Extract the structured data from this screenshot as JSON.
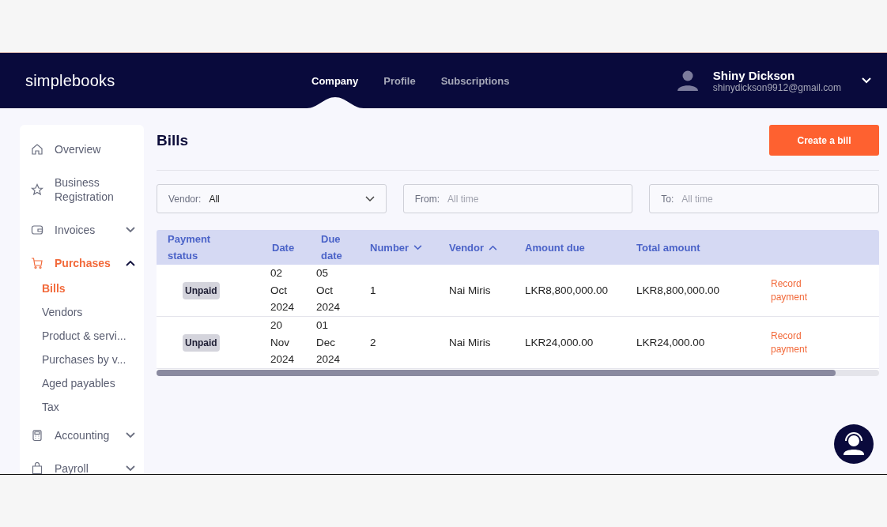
{
  "brand": "simplebooks",
  "nav_tabs": [
    {
      "label": "Company",
      "selected": true
    },
    {
      "label": "Profile",
      "selected": false
    },
    {
      "label": "Subscriptions",
      "selected": false
    }
  ],
  "user": {
    "name": "Shiny Dickson",
    "email": "shinydickson9912@gmail.com"
  },
  "sidebar": {
    "items": [
      {
        "label": "Overview",
        "selected": false
      },
      {
        "label": "Business Registration",
        "selected": false
      },
      {
        "label": "Invoices",
        "selected": false,
        "expanded": false
      },
      {
        "label": "Purchases",
        "selected": true,
        "expanded": true,
        "children": [
          {
            "label": "Bills",
            "selected": true
          },
          {
            "label": "Vendors",
            "selected": false
          },
          {
            "label": "Product & servi...",
            "selected": false
          },
          {
            "label": "Purchases by v...",
            "selected": false
          },
          {
            "label": "Aged payables",
            "selected": false
          },
          {
            "label": "Tax",
            "selected": false
          }
        ]
      },
      {
        "label": "Accounting",
        "selected": false,
        "expanded": false
      },
      {
        "label": "Payroll",
        "selected": false,
        "expanded": false
      }
    ]
  },
  "page_title": "Bills",
  "create_button": "Create a bill",
  "filters": [
    {
      "label": "Vendor:",
      "value": "All",
      "kind": "dropdown"
    },
    {
      "label": "From:",
      "placeholder": "All time",
      "kind": "date"
    },
    {
      "label": "To:",
      "placeholder": "All time",
      "kind": "date"
    }
  ],
  "table": {
    "columns": [
      {
        "label": "Payment status"
      },
      {
        "label": "Date"
      },
      {
        "label": "Due date"
      },
      {
        "label": "Number",
        "sorted_ascending": false
      },
      {
        "label": "Vendor",
        "sorted_ascending": true
      },
      {
        "label": "Amount due"
      },
      {
        "label": "Total amount"
      }
    ],
    "rows": [
      {
        "status": "Unpaid",
        "date": [
          "02",
          "Oct",
          "2024"
        ],
        "due_date": [
          "05",
          "Oct",
          "2024"
        ],
        "number": "1",
        "vendor": "Nai Miris",
        "amount_due": "LKR8,800,000.00",
        "total_amount": "LKR8,800,000.00",
        "action": "Record payment"
      },
      {
        "status": "Unpaid",
        "date": [
          "20",
          "Nov",
          "2024"
        ],
        "due_date": [
          "01",
          "Dec",
          "2024"
        ],
        "number": "2",
        "vendor": "Nai Miris",
        "amount_due": "LKR24,000.00",
        "total_amount": "LKR24,000.00",
        "action": "Record payment"
      }
    ]
  }
}
